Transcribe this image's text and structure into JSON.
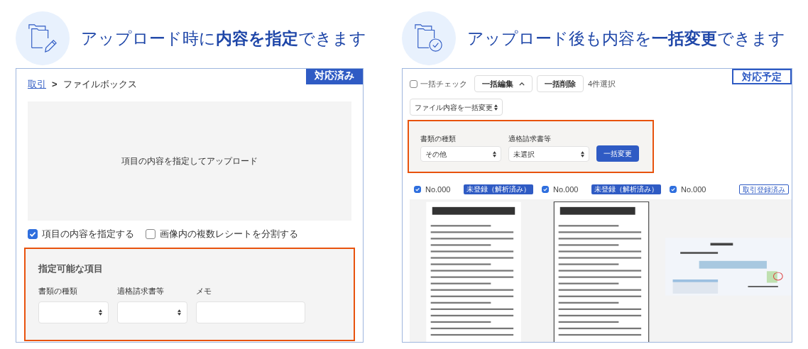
{
  "features": [
    {
      "heading": "アップロード時に**内容を指定**できます",
      "badge": {
        "text": "対応済み",
        "kind": "filled"
      }
    },
    {
      "heading": "アップロード後も内容を**一括変更**できます",
      "badge": {
        "text": "対応予定",
        "kind": "outlined"
      }
    }
  ],
  "upload_screen": {
    "breadcrumb": {
      "link": "取引",
      "separator": ">",
      "current": "ファイルボックス"
    },
    "dropzone": "項目の内容を指定してアップロード",
    "options": [
      {
        "label": "項目の内容を指定する",
        "checked": true
      },
      {
        "label": "画像内の複数レシートを分割する",
        "checked": false
      }
    ],
    "panel": {
      "title": "指定可能な項目",
      "fields": [
        {
          "label": "書類の種類",
          "kind": "select"
        },
        {
          "label": "適格請求書等",
          "kind": "select"
        },
        {
          "label": "メモ",
          "kind": "text"
        }
      ]
    }
  },
  "bulk_screen": {
    "select_all": {
      "label": "一括チェック",
      "checked": false
    },
    "buttons": [
      {
        "label": "一括編集",
        "expanded": true
      },
      {
        "label": "一括削除",
        "expanded": false
      }
    ],
    "selection_count": "4件選択",
    "action_select": "ファイル内容を一括変更",
    "panel": {
      "fields": [
        {
          "label": "書類の種類",
          "value": "その他"
        },
        {
          "label": "適格請求書等",
          "value": "未選択"
        }
      ],
      "apply_button": "一括変更"
    },
    "files": [
      {
        "number": "No.000",
        "checked": true,
        "status": {
          "text": "未登録（解析済み）",
          "kind": "filled"
        }
      },
      {
        "number": "No.000",
        "checked": true,
        "status": {
          "text": "未登録（解析済み）",
          "kind": "filled"
        }
      },
      {
        "number": "No.000",
        "checked": true,
        "status": {
          "text": "取引登録済み",
          "kind": "outlined"
        }
      }
    ]
  }
}
